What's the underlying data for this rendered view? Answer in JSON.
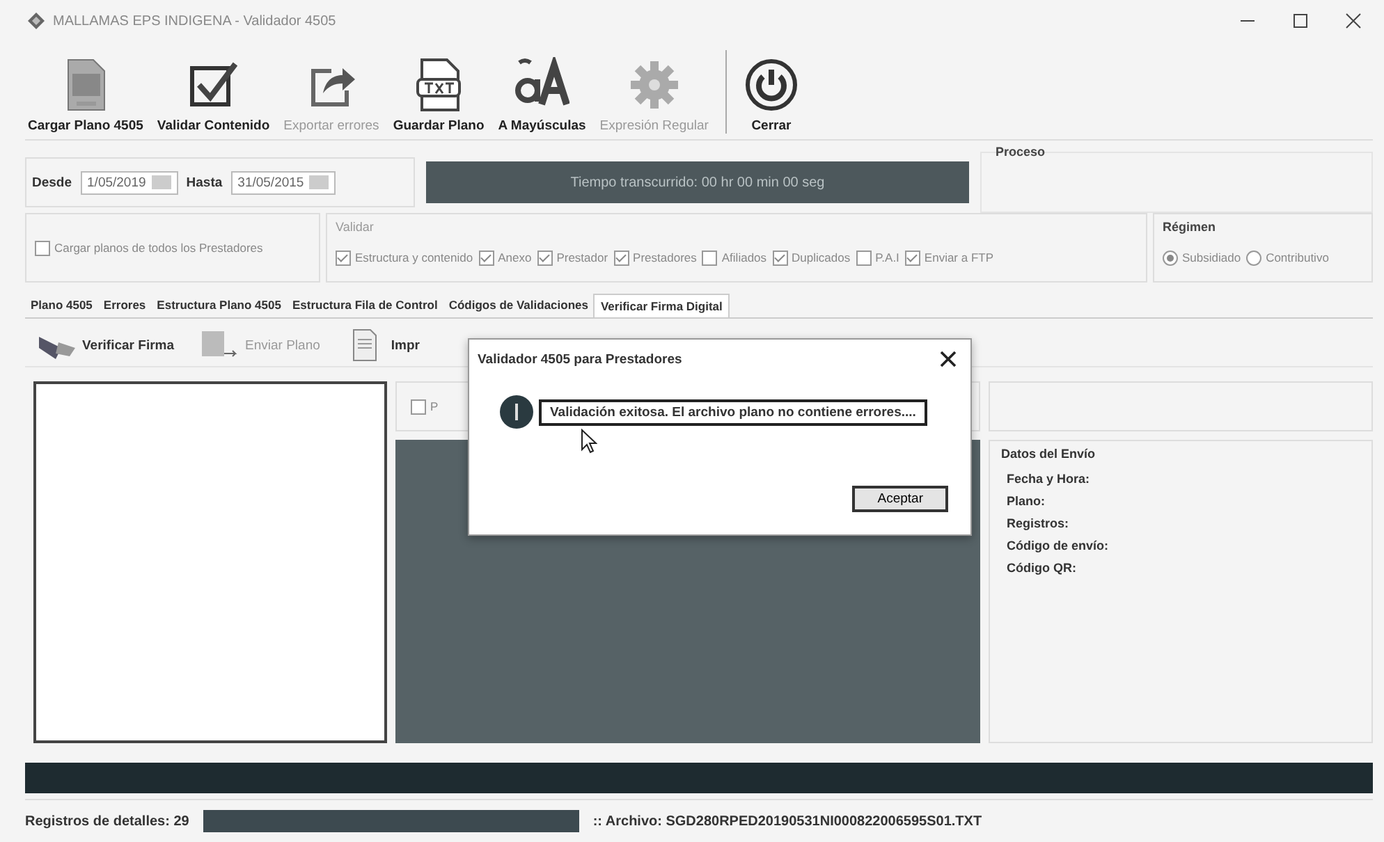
{
  "window": {
    "title": "MALLAMAS EPS INDIGENA - Validador 4505"
  },
  "toolbar": [
    {
      "label": "Cargar Plano 4505",
      "kind": "file",
      "disabled": false
    },
    {
      "label": "Validar Contenido",
      "kind": "check",
      "disabled": false
    },
    {
      "label": "Exportar errores",
      "kind": "export",
      "disabled": true
    },
    {
      "label": "Guardar Plano",
      "kind": "txt",
      "disabled": false
    },
    {
      "label": "A Mayúsculas",
      "kind": "case",
      "disabled": false
    },
    {
      "label": "Expresión Regular",
      "kind": "gear",
      "disabled": true
    },
    {
      "label": "Cerrar",
      "kind": "power",
      "disabled": false
    }
  ],
  "dates": {
    "from_label": "Desde",
    "from": "1/05/2019",
    "to_label": "Hasta",
    "to": "31/05/2015"
  },
  "timer": "Tiempo transcurrido: 00 hr 00 min 00 seg",
  "process": {
    "title": "Proceso"
  },
  "load_all": {
    "label": "Cargar planos de todos los Prestadores",
    "checked": false
  },
  "validate": {
    "title": "Validar",
    "options": [
      {
        "label": "Estructura y contenido",
        "checked": true
      },
      {
        "label": "Anexo",
        "checked": true
      },
      {
        "label": "Prestador",
        "checked": true
      },
      {
        "label": "Prestadores",
        "checked": true
      },
      {
        "label": "Afiliados",
        "checked": false
      },
      {
        "label": "Duplicados",
        "checked": true
      },
      {
        "label": "P.A.I",
        "checked": false
      },
      {
        "label": "Enviar a FTP",
        "checked": true
      }
    ]
  },
  "regime": {
    "title": "Régimen",
    "options": [
      {
        "label": "Subsidiado",
        "selected": true
      },
      {
        "label": "Contributivo",
        "selected": false
      }
    ]
  },
  "tabs": [
    {
      "label": "Plano 4505",
      "selected": false
    },
    {
      "label": "Errores",
      "selected": false
    },
    {
      "label": "Estructura Plano 4505",
      "selected": false
    },
    {
      "label": "Estructura Fila de Control",
      "selected": false
    },
    {
      "label": "Códigos de Validaciones",
      "selected": false
    },
    {
      "label": "Verificar Firma Digital",
      "selected": true
    }
  ],
  "actions": [
    {
      "label": "Verificar Firma",
      "kind": "usb",
      "disabled": false
    },
    {
      "label": "Enviar Plano",
      "kind": "send",
      "disabled": true
    },
    {
      "label": "Impr",
      "kind": "doc",
      "disabled": false
    }
  ],
  "middle_checkbox": {
    "label": "P",
    "checked": false
  },
  "send_data": {
    "title": "Datos del Envío",
    "fields": [
      "Fecha y Hora:",
      "Plano:",
      "Registros:",
      "Código de envío:",
      "Código QR:"
    ]
  },
  "dialog": {
    "title": "Validador 4505 para Prestadores",
    "message": "Validación exitosa. El archivo plano no contiene errores....",
    "button": "Aceptar"
  },
  "progress": {
    "level": 1
  },
  "status_bar": {
    "records": "Registros de detalles: 29",
    "progress": {
      "level": 1
    },
    "file": ":: Archivo: SGD280RPED20190531NI000822006595S01.TXT"
  }
}
